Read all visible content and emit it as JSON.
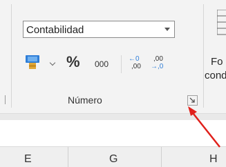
{
  "number_group": {
    "format_value": "Contabilidad",
    "percent_label": "%",
    "thousands_label": "000",
    "increase_decimals_top": "←0",
    "increase_decimals_bottom": ",00",
    "decrease_decimals_top": ",00",
    "decrease_decimals_bottom": "→,0",
    "group_label": "Número"
  },
  "next_group": {
    "label_line1": "Fo",
    "label_line2": "cond"
  },
  "columns": [
    "E",
    "G",
    "H"
  ],
  "colors": {
    "ribbon_bg": "#f3f3f3",
    "currency_icon_blue": "#2f7ed8",
    "coin_gold": "#e0a83a",
    "arrow_blue": "#2f7ed8",
    "annotation_arrow": "#e0201b"
  }
}
